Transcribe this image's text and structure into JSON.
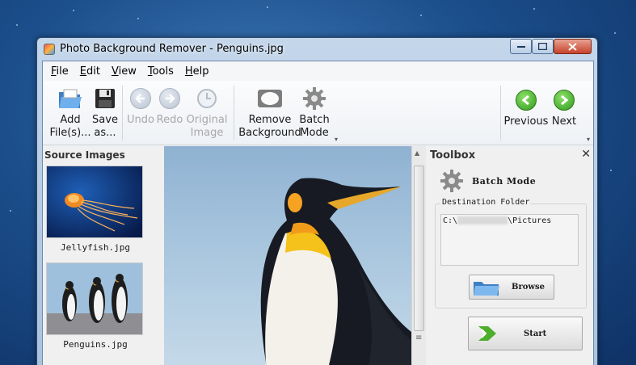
{
  "window": {
    "title": "Photo Background Remover - Penguins.jpg"
  },
  "menu": [
    {
      "label": "File",
      "key": "F",
      "rest": "ile"
    },
    {
      "label": "Edit",
      "key": "E",
      "rest": "dit"
    },
    {
      "label": "View",
      "key": "V",
      "rest": "iew"
    },
    {
      "label": "Tools",
      "key": "T",
      "rest": "ools"
    },
    {
      "label": "Help",
      "key": "H",
      "rest": "elp"
    }
  ],
  "toolbar": {
    "add_files": [
      "Add",
      "File(s)..."
    ],
    "save_as": [
      "Save",
      "as..."
    ],
    "undo": "Undo",
    "redo": "Redo",
    "original_image": [
      "Original",
      "Image"
    ],
    "remove_background": [
      "Remove",
      "Background"
    ],
    "batch_mode": [
      "Batch",
      "Mode"
    ],
    "previous": "Previous",
    "next": "Next"
  },
  "source_images": {
    "title": "Source Images",
    "items": [
      {
        "label": "Jellyfish.jpg"
      },
      {
        "label": "Penguins.jpg"
      }
    ]
  },
  "toolbox": {
    "title": "Toolbox",
    "close": "✕",
    "mode_label": "Batch Mode",
    "destination_title": "Destination Folder",
    "destination_prefix": "C:\\",
    "destination_suffix": "\\Pictures",
    "browse_label": "Browse",
    "start_label": "Start"
  },
  "colors": {
    "accent_green": "#2f9a1e",
    "folder_blue": "#4a90d9"
  }
}
